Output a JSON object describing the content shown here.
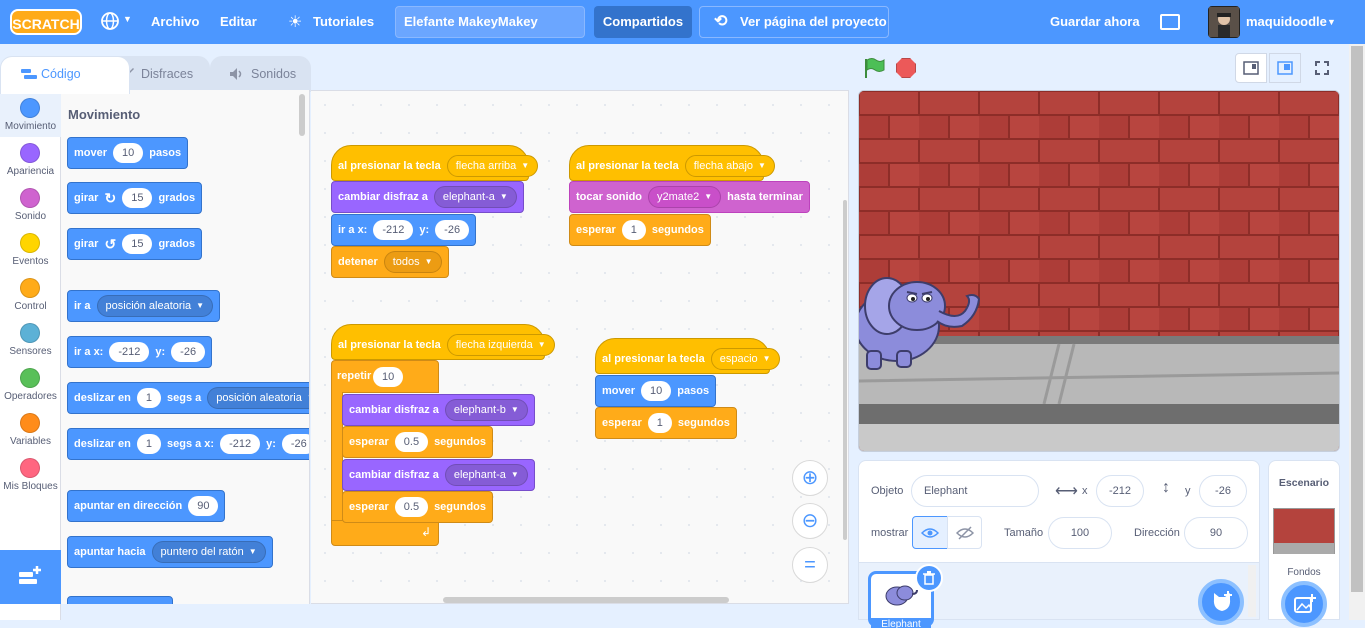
{
  "menubar": {
    "logo": "SCRATCH",
    "archivo": "Archivo",
    "editar": "Editar",
    "tutoriales": "Tutoriales",
    "project_title": "Elefante MakeyMakey",
    "compartidos": "Compartidos",
    "ver_pagina": "Ver página del proyecto",
    "guardar": "Guardar ahora",
    "username": "maquidoodle"
  },
  "tabs": [
    {
      "label": "Código"
    },
    {
      "label": "Disfraces"
    },
    {
      "label": "Sonidos"
    }
  ],
  "categories": [
    {
      "label": "Movimiento",
      "color": "#4c97ff"
    },
    {
      "label": "Apariencia",
      "color": "#9966ff"
    },
    {
      "label": "Sonido",
      "color": "#cf63cf"
    },
    {
      "label": "Eventos",
      "color": "#ffd500"
    },
    {
      "label": "Control",
      "color": "#ffab19"
    },
    {
      "label": "Sensores",
      "color": "#5cb1d6"
    },
    {
      "label": "Operadores",
      "color": "#59c059"
    },
    {
      "label": "Variables",
      "color": "#ff8c1a"
    },
    {
      "label": "Mis Bloques",
      "color": "#ff6680"
    }
  ],
  "palette": {
    "title": "Movimiento",
    "mover": {
      "a": "mover",
      "v": "10",
      "b": "pasos"
    },
    "girar_r": {
      "a": "girar",
      "v": "15",
      "b": "grados"
    },
    "girar_l": {
      "a": "girar",
      "v": "15",
      "b": "grados"
    },
    "ir_a": {
      "a": "ir a",
      "d": "posición aleatoria"
    },
    "ir_a_xy": {
      "a": "ir a x:",
      "x": "-212",
      "y_lbl": "y:",
      "y": "-26"
    },
    "deslizar": {
      "a": "deslizar en",
      "v": "1",
      "b": "segs a",
      "d": "posición aleatoria"
    },
    "deslizar_xy": {
      "a": "deslizar en",
      "v": "1",
      "b": "segs a x:",
      "x": "-212",
      "y_lbl": "y:",
      "y": "-26"
    },
    "apuntar_dir": {
      "a": "apuntar en dirección",
      "v": "90"
    },
    "apuntar_hacia": {
      "a": "apuntar hacia",
      "d": "puntero del ratón"
    }
  },
  "script1": {
    "hat": "al presionar la tecla",
    "key": "flecha arriba",
    "costume": "cambiar disfraz a",
    "costume_v": "elephant-a",
    "goto": "ir a x:",
    "x": "-212",
    "y_lbl": "y:",
    "y": "-26",
    "stop": "detener",
    "stop_v": "todos"
  },
  "script2": {
    "hat": "al presionar la tecla",
    "key": "flecha abajo",
    "sound": "tocar sonido",
    "sound_v": "y2mate2",
    "until": "hasta terminar",
    "wait": "esperar",
    "wait_v": "1",
    "wait_u": "segundos"
  },
  "script3": {
    "hat": "al presionar la tecla",
    "key": "flecha izquierda",
    "repeat": "repetir",
    "repeat_v": "10",
    "c1": "cambiar disfraz a",
    "c1_v": "elephant-b",
    "w1": "esperar",
    "w1_v": "0.5",
    "w1_u": "segundos",
    "c2": "cambiar disfraz a",
    "c2_v": "elephant-a",
    "w2": "esperar",
    "w2_v": "0.5",
    "w2_u": "segundos"
  },
  "script4": {
    "hat": "al presionar la tecla",
    "key": "espacio",
    "move": "mover",
    "move_v": "10",
    "move_u": "pasos",
    "wait": "esperar",
    "wait_v": "1",
    "wait_u": "segundos"
  },
  "sprite_info": {
    "objeto_lbl": "Objeto",
    "name": "Elephant",
    "x_lbl": "x",
    "x": "-212",
    "y_lbl": "y",
    "y": "-26",
    "mostrar": "mostrar",
    "tamano_lbl": "Tamaño",
    "tamano": "100",
    "direccion_lbl": "Dirección",
    "direccion": "90"
  },
  "stage_pane": {
    "title": "Escenario",
    "fondos": "Fondos"
  },
  "sprite_list": [
    {
      "name": "Elephant"
    }
  ]
}
